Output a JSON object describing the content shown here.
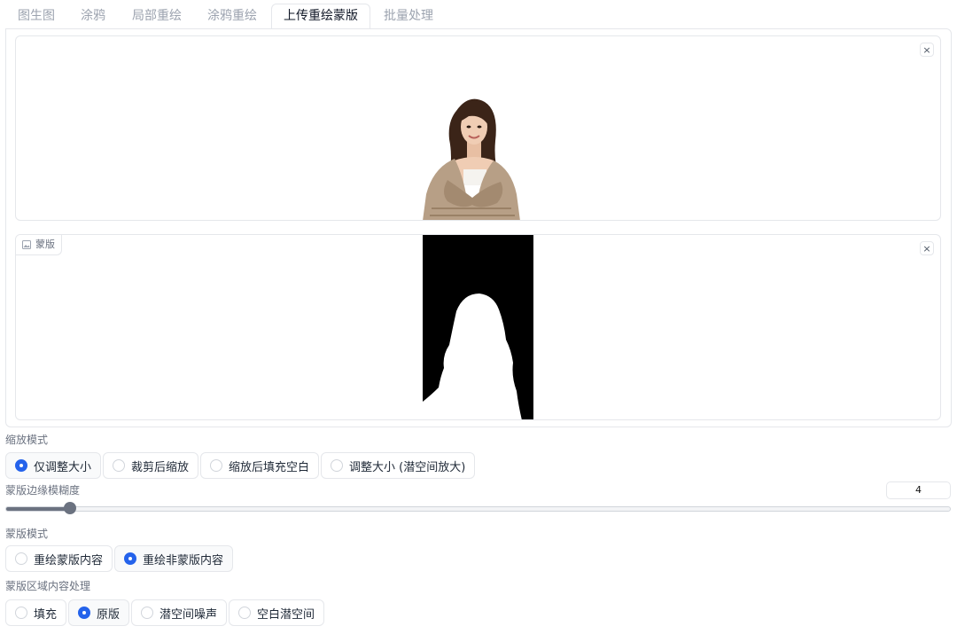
{
  "tabs": [
    {
      "label": "图生图",
      "active": false
    },
    {
      "label": "涂鸦",
      "active": false
    },
    {
      "label": "局部重绘",
      "active": false
    },
    {
      "label": "涂鸦重绘",
      "active": false
    },
    {
      "label": "上传重绘蒙版",
      "active": true
    },
    {
      "label": "批量处理",
      "active": false
    }
  ],
  "image_box": {
    "close": "×"
  },
  "mask_box": {
    "label": "蒙版",
    "close": "×"
  },
  "resize_mode": {
    "label": "缩放模式",
    "options": [
      "仅调整大小",
      "裁剪后缩放",
      "缩放后填充空白",
      "调整大小 (潜空间放大)"
    ],
    "selected_index": 0
  },
  "mask_blur": {
    "label": "蒙版边缘模糊度",
    "value": "4",
    "fraction": 0.068
  },
  "mask_mode": {
    "label": "蒙版模式",
    "options": [
      "重绘蒙版内容",
      "重绘非蒙版内容"
    ],
    "selected_index": 1
  },
  "masked_content": {
    "label": "蒙版区域内容处理",
    "options": [
      "填充",
      "原版",
      "潜空间噪声",
      "空白潜空间"
    ],
    "selected_index": 1
  },
  "colors": {
    "accent": "#2563eb",
    "border": "#e5e7eb",
    "slider": "#6b7280"
  }
}
